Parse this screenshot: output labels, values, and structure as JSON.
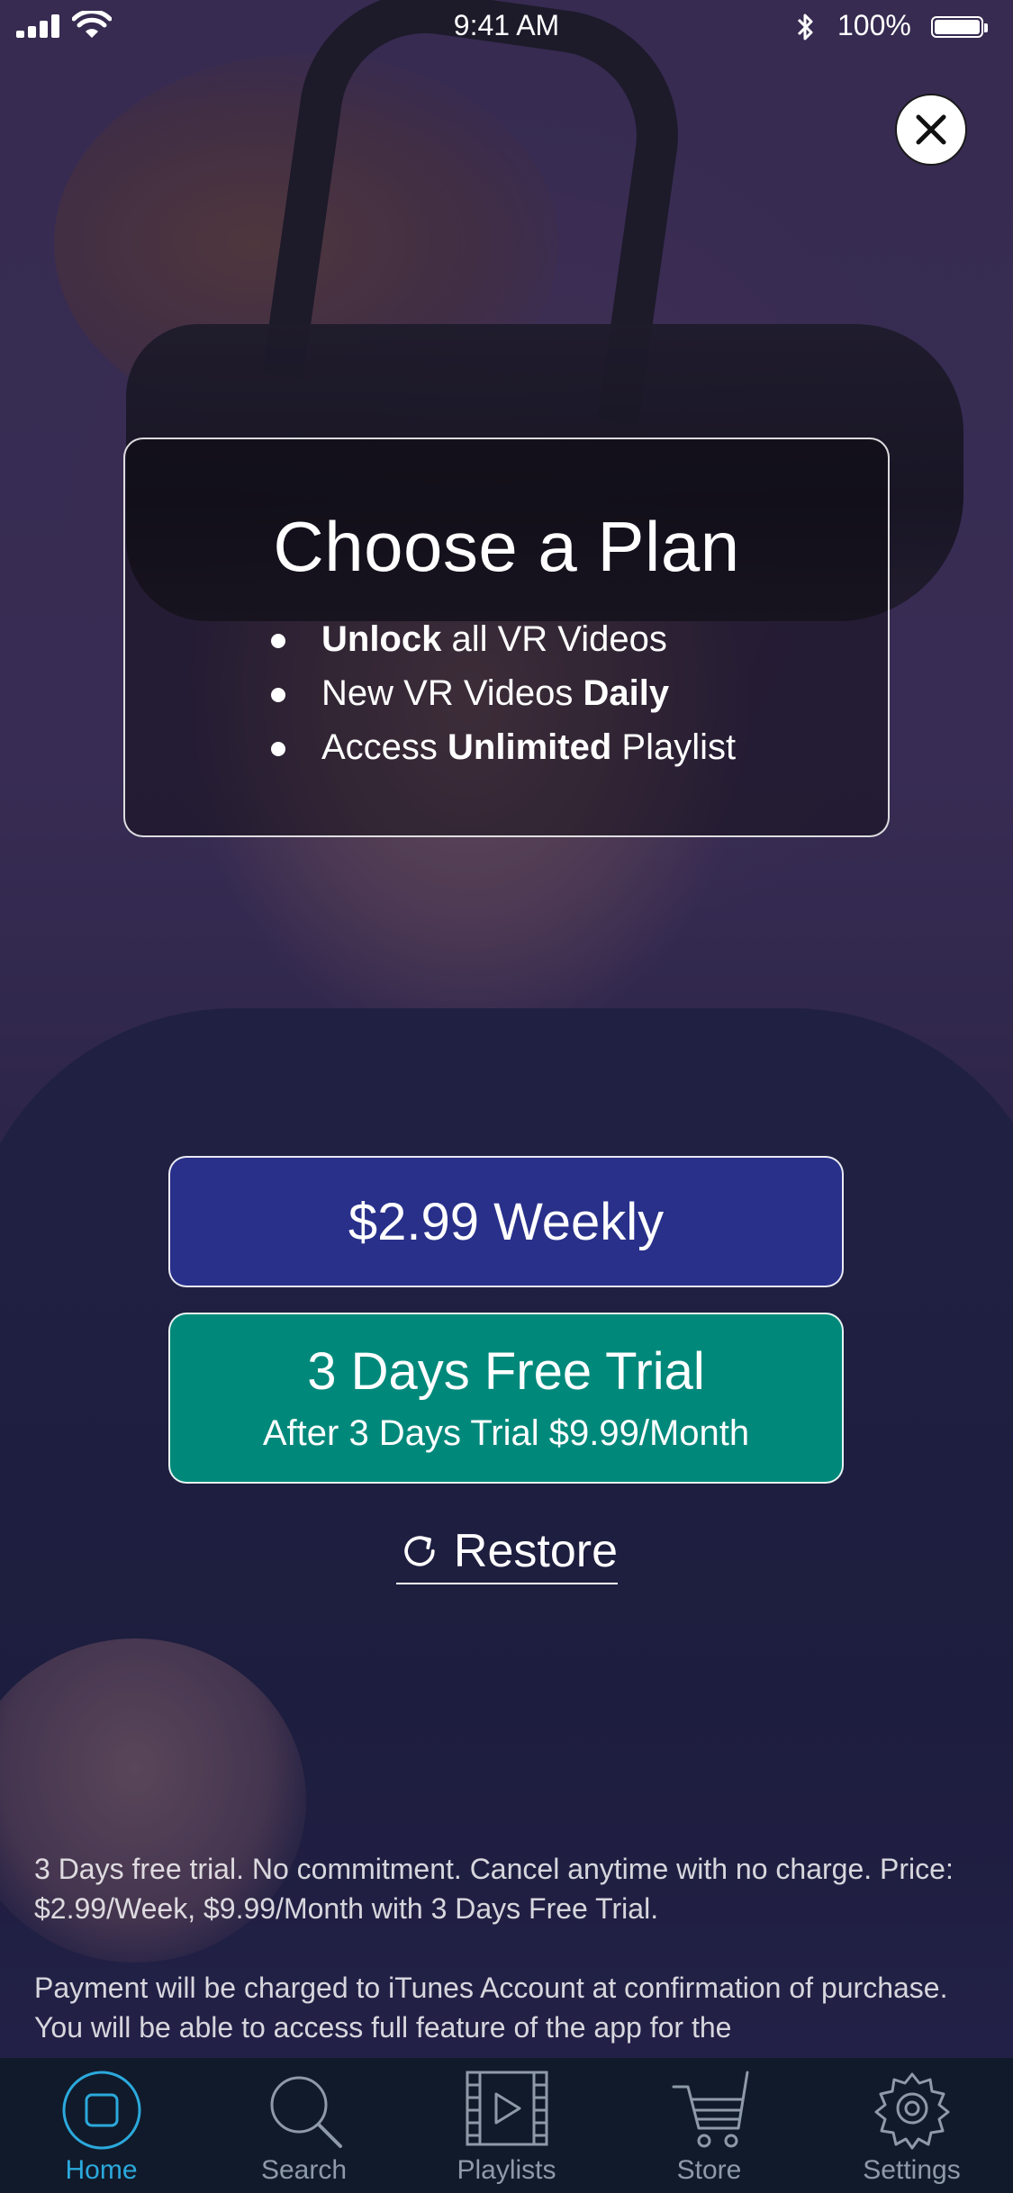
{
  "status_bar": {
    "time": "9:41 AM",
    "battery_percent": "100%",
    "battery_level": 1.0
  },
  "plan_card": {
    "title": "Choose a Plan",
    "features": [
      {
        "bold": "Unlock",
        "rest": " all VR Videos"
      },
      {
        "pre": "New VR Videos ",
        "bold": "Daily"
      },
      {
        "pre": "Access ",
        "bold": "Unlimited",
        "rest": " Playlist"
      }
    ]
  },
  "buttons": {
    "weekly_label": "$2.99 Weekly",
    "trial_title": "3 Days Free Trial",
    "trial_subtitle": "After 3 Days Trial $9.99/Month",
    "restore_label": "Restore"
  },
  "legal": {
    "paragraph1": "3 Days free trial. No commitment. Cancel anytime with no charge. Price: $2.99/Week, $9.99/Month with 3 Days Free Trial.",
    "paragraph2": "Payment will be charged to iTunes Account at confirmation of purchase. You will be able to access full feature of the app for the"
  },
  "tab_bar": {
    "tabs": [
      {
        "label": "Home",
        "icon": "home-icon",
        "active": true
      },
      {
        "label": "Search",
        "icon": "search-icon",
        "active": false
      },
      {
        "label": "Playlists",
        "icon": "playlists-icon",
        "active": false
      },
      {
        "label": "Store",
        "icon": "cart-icon",
        "active": false
      },
      {
        "label": "Settings",
        "icon": "gear-icon",
        "active": false
      }
    ]
  },
  "colors": {
    "weekly_button": "#28308a",
    "trial_button": "#00897b",
    "tab_active": "#2ba9dc",
    "tab_inactive": "#8f9aa8",
    "tab_bar_bg": "#111a2a"
  }
}
